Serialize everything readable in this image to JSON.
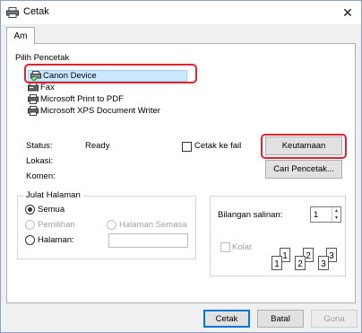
{
  "window": {
    "title": "Cetak",
    "close_glyph": "✕"
  },
  "tabs": [
    {
      "label": "Am"
    }
  ],
  "printer_group": {
    "title": "Pilih Pencetak",
    "printers": [
      {
        "name": "Canon Device",
        "selected": true,
        "icon": "printer-default-icon"
      },
      {
        "name": "Fax",
        "selected": false,
        "icon": "fax-printer-icon"
      },
      {
        "name": "Microsoft Print to PDF",
        "selected": false,
        "icon": "printer-icon"
      },
      {
        "name": "Microsoft XPS Document Writer",
        "selected": false,
        "icon": "printer-icon"
      }
    ],
    "status_label": "Status:",
    "status_value": "Ready",
    "location_label": "Lokasi:",
    "comment_label": "Komen:",
    "print_to_file_label": "Cetak ke fail",
    "preferences_button": "Keutamaan",
    "find_printer_button": "Cari Pencetak..."
  },
  "page_range": {
    "title": "Julat Halaman",
    "all_label": "Semua",
    "selection_label": "Pemilihan",
    "current_page_label": "Halaman Semasa",
    "pages_label": "Halaman:",
    "pages_value": ""
  },
  "copies": {
    "count_label": "Bilangan salinan:",
    "count_value": "1",
    "collate_label": "Kolat",
    "collate_pages": [
      "1",
      "1",
      "2",
      "2",
      "3",
      "3"
    ]
  },
  "footer": {
    "print_button": "Cetak",
    "cancel_button": "Batal",
    "apply_button": "Guna"
  },
  "colors": {
    "highlight": "#e0232c",
    "selection_bg": "#cce8ff",
    "accent": "#0078d7"
  }
}
